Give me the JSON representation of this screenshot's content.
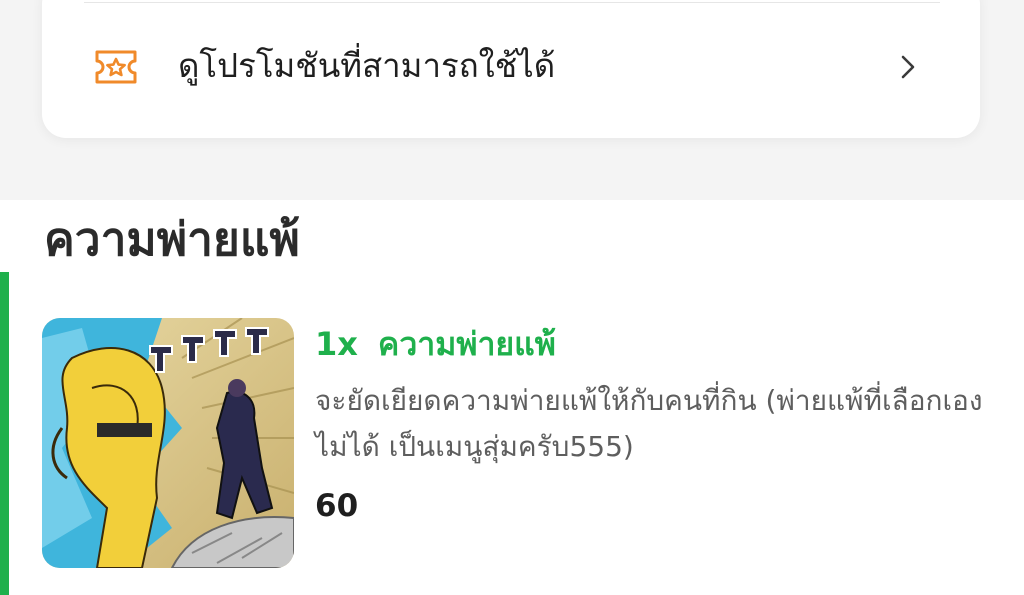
{
  "promo": {
    "label": "ดูโปรโมชันที่สามารถใช้ได้",
    "icon": "ticket-star-icon",
    "accent_color": "#f08a2a"
  },
  "section": {
    "title": "ความพ่ายแพ้",
    "accent_color": "#1fb04c"
  },
  "item": {
    "quantity": "1x",
    "name": "ความพ่ายแพ้",
    "description": "จะยัดเยียดความพ่ายแพ้ให้กับคนที่กิน (พ่ายแพ้ที่เลือกเองไม่ได้ เป็นเมนูสุ่มครับ555)",
    "price": "60",
    "image": "manga-illustration"
  }
}
